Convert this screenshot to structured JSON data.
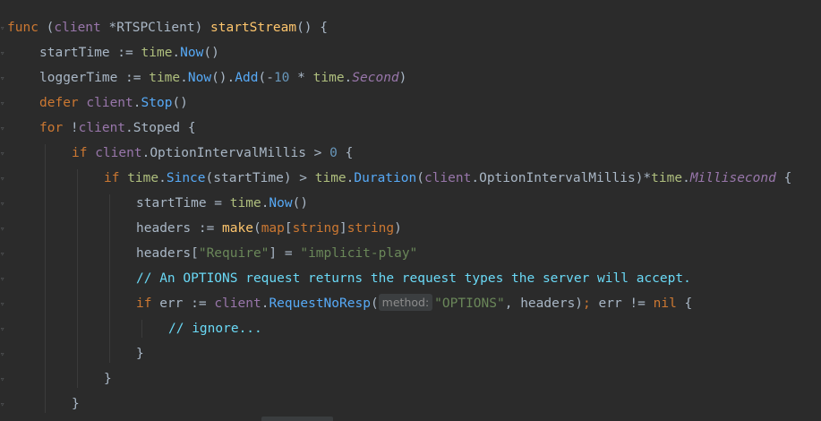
{
  "editor": {
    "lines": [
      {
        "indent": 0,
        "tokens": [
          {
            "t": "func",
            "c": "kw"
          },
          {
            "t": " (",
            "c": "op"
          },
          {
            "t": "client",
            "c": "rcv"
          },
          {
            "t": " *",
            "c": "op"
          },
          {
            "t": "RTSPClient",
            "c": "var"
          },
          {
            "t": ") ",
            "c": "op"
          },
          {
            "t": "startStream",
            "c": "fn"
          },
          {
            "t": "() {",
            "c": "op"
          }
        ]
      },
      {
        "indent": 1,
        "tokens": [
          {
            "t": "startTime := ",
            "c": "var"
          },
          {
            "t": "time",
            "c": "pkg"
          },
          {
            "t": ".",
            "c": "op"
          },
          {
            "t": "Now",
            "c": "mth"
          },
          {
            "t": "()",
            "c": "op"
          }
        ]
      },
      {
        "indent": 1,
        "tokens": [
          {
            "t": "loggerTime := ",
            "c": "var"
          },
          {
            "t": "time",
            "c": "pkg"
          },
          {
            "t": ".",
            "c": "op"
          },
          {
            "t": "Now",
            "c": "mth"
          },
          {
            "t": "().",
            "c": "op"
          },
          {
            "t": "Add",
            "c": "mth"
          },
          {
            "t": "(-",
            "c": "op"
          },
          {
            "t": "10",
            "c": "num"
          },
          {
            "t": " * ",
            "c": "op"
          },
          {
            "t": "time",
            "c": "pkg"
          },
          {
            "t": ".",
            "c": "op"
          },
          {
            "t": "Second",
            "c": "cst"
          },
          {
            "t": ")",
            "c": "op"
          }
        ]
      },
      {
        "indent": 1,
        "tokens": [
          {
            "t": "defer ",
            "c": "kw"
          },
          {
            "t": "client",
            "c": "rcv"
          },
          {
            "t": ".",
            "c": "op"
          },
          {
            "t": "Stop",
            "c": "mth"
          },
          {
            "t": "()",
            "c": "op"
          }
        ]
      },
      {
        "indent": 1,
        "tokens": [
          {
            "t": "for ",
            "c": "kw"
          },
          {
            "t": "!",
            "c": "op"
          },
          {
            "t": "client",
            "c": "rcv"
          },
          {
            "t": ".",
            "c": "op"
          },
          {
            "t": "Stoped",
            "c": "var"
          },
          {
            "t": " {",
            "c": "op"
          }
        ]
      },
      {
        "indent": 2,
        "tokens": [
          {
            "t": "if ",
            "c": "kw"
          },
          {
            "t": "client",
            "c": "rcv"
          },
          {
            "t": ".",
            "c": "op"
          },
          {
            "t": "OptionIntervalMillis",
            "c": "var"
          },
          {
            "t": " > ",
            "c": "op"
          },
          {
            "t": "0",
            "c": "num"
          },
          {
            "t": " {",
            "c": "op"
          }
        ]
      },
      {
        "indent": 3,
        "tokens": [
          {
            "t": "if ",
            "c": "kw"
          },
          {
            "t": "time",
            "c": "pkg"
          },
          {
            "t": ".",
            "c": "op"
          },
          {
            "t": "Since",
            "c": "mth"
          },
          {
            "t": "(startTime) > ",
            "c": "op"
          },
          {
            "t": "time",
            "c": "pkg"
          },
          {
            "t": ".",
            "c": "op"
          },
          {
            "t": "Duration",
            "c": "mth"
          },
          {
            "t": "(",
            "c": "op"
          },
          {
            "t": "client",
            "c": "rcv"
          },
          {
            "t": ".",
            "c": "op"
          },
          {
            "t": "OptionIntervalMillis",
            "c": "var"
          },
          {
            "t": ")*",
            "c": "op"
          },
          {
            "t": "time",
            "c": "pkg"
          },
          {
            "t": ".",
            "c": "op"
          },
          {
            "t": "Millisecond",
            "c": "cst"
          },
          {
            "t": " {",
            "c": "op"
          }
        ]
      },
      {
        "indent": 4,
        "tokens": [
          {
            "t": "startTime = ",
            "c": "var"
          },
          {
            "t": "time",
            "c": "pkg"
          },
          {
            "t": ".",
            "c": "op"
          },
          {
            "t": "Now",
            "c": "mth"
          },
          {
            "t": "()",
            "c": "op"
          }
        ]
      },
      {
        "indent": 4,
        "tokens": [
          {
            "t": "headers := ",
            "c": "var"
          },
          {
            "t": "make",
            "c": "fn"
          },
          {
            "t": "(",
            "c": "op"
          },
          {
            "t": "map",
            "c": "kw"
          },
          {
            "t": "[",
            "c": "op"
          },
          {
            "t": "string",
            "c": "kw"
          },
          {
            "t": "]",
            "c": "op"
          },
          {
            "t": "string",
            "c": "kw"
          },
          {
            "t": ")",
            "c": "op"
          }
        ]
      },
      {
        "indent": 4,
        "tokens": [
          {
            "t": "headers[",
            "c": "var"
          },
          {
            "t": "\"Require\"",
            "c": "str"
          },
          {
            "t": "] = ",
            "c": "op"
          },
          {
            "t": "\"implicit-play\"",
            "c": "str"
          }
        ]
      },
      {
        "indent": 4,
        "tokens": [
          {
            "t": "// An OPTIONS request returns the request types the server will accept.",
            "c": "cmt"
          }
        ]
      },
      {
        "indent": 4,
        "tokens": [
          {
            "t": "if ",
            "c": "kw"
          },
          {
            "t": "err := ",
            "c": "var"
          },
          {
            "t": "client",
            "c": "rcv"
          },
          {
            "t": ".",
            "c": "op"
          },
          {
            "t": "RequestNoResp",
            "c": "mth"
          },
          {
            "t": "(",
            "c": "op"
          },
          {
            "t": "method:",
            "c": "hint"
          },
          {
            "t": "\"OPTIONS\"",
            "c": "str"
          },
          {
            "t": ", headers)",
            "c": "op"
          },
          {
            "t": "; ",
            "c": "kw"
          },
          {
            "t": "err != ",
            "c": "var"
          },
          {
            "t": "nil",
            "c": "kw"
          },
          {
            "t": " {",
            "c": "op"
          }
        ]
      },
      {
        "indent": 5,
        "tokens": [
          {
            "t": "// ignore...",
            "c": "cmt"
          }
        ]
      },
      {
        "indent": 4,
        "tokens": [
          {
            "t": "}",
            "c": "op"
          }
        ]
      },
      {
        "indent": 3,
        "tokens": [
          {
            "t": "}",
            "c": "op"
          }
        ]
      },
      {
        "indent": 2,
        "tokens": [
          {
            "t": "}",
            "c": "op"
          }
        ]
      }
    ]
  }
}
